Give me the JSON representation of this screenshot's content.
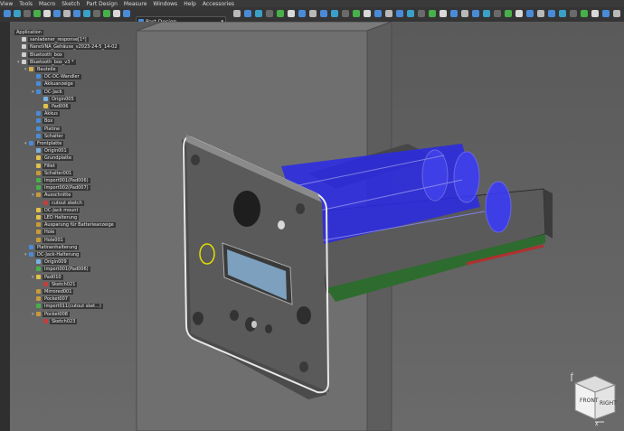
{
  "menu": [
    "View",
    "Tools",
    "Macro",
    "Sketch",
    "Part Design",
    "Measure",
    "Windows",
    "Help",
    "Accessories"
  ],
  "workbench": {
    "label": "Part Design"
  },
  "tree": [
    {
      "label": "Application",
      "depth": 0,
      "icon": "none",
      "expander": ""
    },
    {
      "label": "sanladener_response[1*]",
      "depth": 1,
      "icon": "document-icon",
      "expander": ""
    },
    {
      "label": "NanoVNA_Gehäuse_v2023-24-5_14-02",
      "depth": 1,
      "icon": "document-icon",
      "expander": ""
    },
    {
      "label": "Bluetooth_box",
      "depth": 1,
      "icon": "document-icon",
      "expander": ""
    },
    {
      "label": "Bluetooth_box_v3 *",
      "depth": 1,
      "icon": "document-icon",
      "expander": "▾"
    },
    {
      "label": "Bauteile",
      "depth": 2,
      "icon": "folder-icon",
      "expander": "▾"
    },
    {
      "label": "DC-DC-Wandler",
      "depth": 3,
      "icon": "part-icon",
      "expander": ""
    },
    {
      "label": "Akkuanzeige",
      "depth": 3,
      "icon": "part-icon",
      "expander": ""
    },
    {
      "label": "DC-Jack",
      "depth": 3,
      "icon": "part-icon",
      "expander": "▾"
    },
    {
      "label": "Origin005",
      "depth": 4,
      "icon": "origin-icon",
      "expander": ""
    },
    {
      "label": "Pad006",
      "depth": 4,
      "icon": "pad-icon",
      "expander": ""
    },
    {
      "label": "Akkus",
      "depth": 3,
      "icon": "part-icon",
      "expander": ""
    },
    {
      "label": "Box",
      "depth": 3,
      "icon": "part-icon",
      "expander": ""
    },
    {
      "label": "Platine",
      "depth": 3,
      "icon": "part-icon",
      "expander": ""
    },
    {
      "label": "Schalter",
      "depth": 3,
      "icon": "part-icon",
      "expander": ""
    },
    {
      "label": "Frontplatte",
      "depth": 2,
      "icon": "body-icon",
      "expander": "▾"
    },
    {
      "label": "Origin001",
      "depth": 3,
      "icon": "origin-icon",
      "expander": ""
    },
    {
      "label": "Grundplatte",
      "depth": 3,
      "icon": "pad-icon",
      "expander": ""
    },
    {
      "label": "Fillet",
      "depth": 3,
      "icon": "fillet-icon",
      "expander": ""
    },
    {
      "label": "Schalter001",
      "depth": 3,
      "icon": "pocket-icon",
      "expander": ""
    },
    {
      "label": "Import001(Pad006)",
      "depth": 3,
      "icon": "import-icon",
      "expander": ""
    },
    {
      "label": "Import002(Pad007)",
      "depth": 3,
      "icon": "import-icon",
      "expander": ""
    },
    {
      "label": "Ausschnitte",
      "depth": 3,
      "icon": "pocket-icon",
      "expander": "▾"
    },
    {
      "label": "cutout sketch",
      "depth": 4,
      "icon": "sketch-icon",
      "expander": ""
    },
    {
      "label": "DC-Jack mount",
      "depth": 3,
      "icon": "pad-icon",
      "expander": ""
    },
    {
      "label": "LED Halterung",
      "depth": 3,
      "icon": "pad-icon",
      "expander": ""
    },
    {
      "label": "Ausparung für Batterieanzeige",
      "depth": 3,
      "icon": "pocket-icon",
      "expander": ""
    },
    {
      "label": "Hole",
      "depth": 3,
      "icon": "hole-icon",
      "expander": ""
    },
    {
      "label": "Hole001",
      "depth": 3,
      "icon": "hole-icon",
      "expander": ""
    },
    {
      "label": "Platinenhalterung",
      "depth": 2,
      "icon": "body-icon",
      "expander": ""
    },
    {
      "label": "DC-Jack-Halterung",
      "depth": 2,
      "icon": "body-icon",
      "expander": "▾"
    },
    {
      "label": "Origin009",
      "depth": 3,
      "icon": "origin-icon",
      "expander": ""
    },
    {
      "label": "Import001(Pad006)",
      "depth": 3,
      "icon": "import-icon",
      "expander": ""
    },
    {
      "label": "Pad010",
      "depth": 3,
      "icon": "pad-icon",
      "expander": "▾"
    },
    {
      "label": "Sketch021",
      "depth": 4,
      "icon": "sketch-icon",
      "expander": ""
    },
    {
      "label": "Mirrored001",
      "depth": 3,
      "icon": "mirror-icon",
      "expander": ""
    },
    {
      "label": "Pocket007",
      "depth": 3,
      "icon": "pocket-icon",
      "expander": ""
    },
    {
      "label": "Import011(cutout sket...)",
      "depth": 3,
      "icon": "import-icon",
      "expander": ""
    },
    {
      "label": "Pocket008",
      "depth": 3,
      "icon": "pocket-icon",
      "expander": "▾"
    },
    {
      "label": "Sketch023",
      "depth": 4,
      "icon": "sketch-icon",
      "expander": ""
    }
  ],
  "navcube": {
    "front": "FRONT",
    "right": "RIGHT",
    "axis_z": "Z",
    "axis_x": "X",
    "axis_y": "Y"
  },
  "colors": {
    "accent": "#4a8bd8",
    "battery": "#2a2aff",
    "selection": "#e3e000"
  }
}
